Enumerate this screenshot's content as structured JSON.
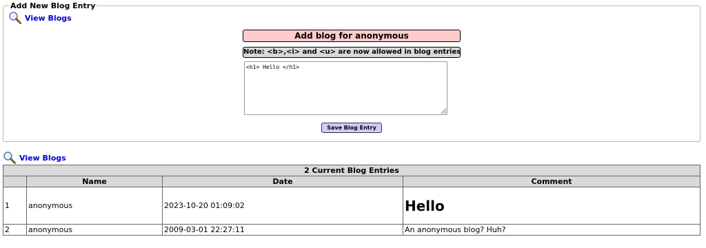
{
  "form": {
    "legend": "Add New Blog Entry",
    "view_link_label": "View Blogs",
    "title": "Add blog for anonymous",
    "note": "Note: <b>,<i> and <u> are now allowed in blog entries",
    "textarea_value": "<h1> Hello </h1>",
    "save_label": "Save Blog Entry"
  },
  "view_link_label": "View Blogs",
  "table": {
    "caption": "2 Current Blog Entries",
    "headers": [
      "",
      "Name",
      "Date",
      "Comment"
    ],
    "rows": [
      {
        "num": "1",
        "name": "anonymous",
        "date": "2023-10-20 01:09:02",
        "comment": "Hello"
      },
      {
        "num": "2",
        "name": "anonymous",
        "date": "2009-03-01 22:27:11",
        "comment": "An anonymous blog? Huh?"
      }
    ]
  },
  "colors": {
    "title_bg": "#ffcccc",
    "note_bg": "#d9d9d9",
    "button_bg": "#ccccff",
    "link": "#0000cc"
  },
  "icons": [
    "magnifier-icon"
  ]
}
